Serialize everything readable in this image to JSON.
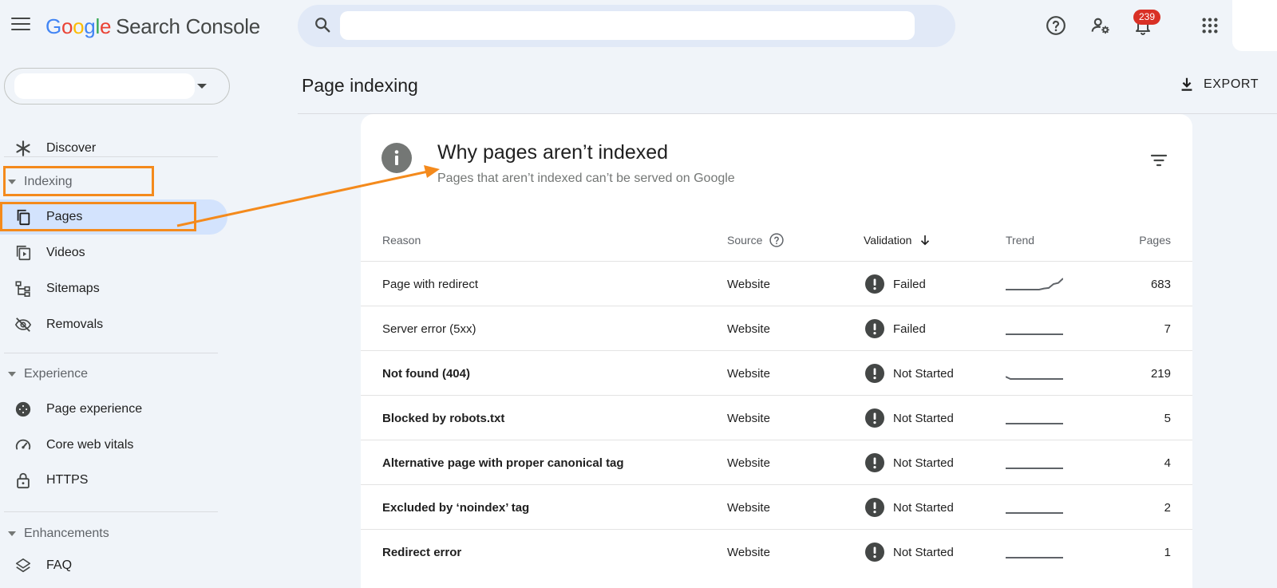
{
  "app": {
    "logo_letters": [
      "G",
      "o",
      "o",
      "g",
      "l",
      "e"
    ],
    "product": "Search Console"
  },
  "topbar": {
    "search_placeholder": "",
    "notification_count": "239",
    "icons": [
      "menu-icon",
      "search-icon",
      "help-icon",
      "admin-settings-icon",
      "notifications-icon",
      "apps-grid-icon"
    ]
  },
  "sidebar": {
    "discover": "Discover",
    "indexing": {
      "label": "Indexing",
      "items": [
        {
          "label": "Pages",
          "icon": "pages-icon",
          "active": true
        },
        {
          "label": "Videos",
          "icon": "video-icon"
        },
        {
          "label": "Sitemaps",
          "icon": "sitemap-icon"
        },
        {
          "label": "Removals",
          "icon": "removals-icon"
        }
      ]
    },
    "experience": {
      "label": "Experience",
      "items": [
        {
          "label": "Page experience",
          "icon": "page-experience-icon"
        },
        {
          "label": "Core web vitals",
          "icon": "speed-gauge-icon"
        },
        {
          "label": "HTTPS",
          "icon": "lock-icon"
        }
      ]
    },
    "enhancements": {
      "label": "Enhancements",
      "items": [
        {
          "label": "FAQ",
          "icon": "layers-icon"
        }
      ]
    }
  },
  "main": {
    "page_title": "Page indexing",
    "export_label": "EXPORT",
    "card": {
      "title": "Why pages aren’t indexed",
      "subtitle": "Pages that aren’t indexed can’t be served on Google",
      "columns": {
        "reason": "Reason",
        "source": "Source",
        "validation": "Validation",
        "trend": "Trend",
        "pages": "Pages"
      },
      "rows": [
        {
          "reason": "Page with redirect",
          "source": "Website",
          "validation": "Failed",
          "trend": [
            0,
            0,
            0,
            0,
            0,
            0,
            0,
            0,
            0.1,
            0.15,
            0.5,
            0.6,
            1
          ],
          "pages": "683",
          "bold": false
        },
        {
          "reason": "Server error (5xx)",
          "source": "Website",
          "validation": "Failed",
          "trend": [
            0,
            0,
            0,
            0,
            0,
            0,
            0,
            0,
            0,
            0,
            0,
            0,
            0
          ],
          "pages": "7",
          "bold": false
        },
        {
          "reason": "Not found (404)",
          "source": "Website",
          "validation": "Not Started",
          "trend": [
            0.2,
            0,
            0,
            0,
            0,
            0,
            0,
            0,
            0,
            0,
            0,
            0,
            0
          ],
          "pages": "219",
          "bold": true
        },
        {
          "reason": "Blocked by robots.txt",
          "source": "Website",
          "validation": "Not Started",
          "trend": [
            0,
            0,
            0,
            0,
            0,
            0,
            0,
            0,
            0,
            0,
            0,
            0,
            0
          ],
          "pages": "5",
          "bold": true
        },
        {
          "reason": "Alternative page with proper canonical tag",
          "source": "Website",
          "validation": "Not Started",
          "trend": [
            0,
            0,
            0,
            0,
            0,
            0,
            0,
            0,
            0,
            0,
            0,
            0,
            0
          ],
          "pages": "4",
          "bold": true
        },
        {
          "reason": "Excluded by ‘noindex’ tag",
          "source": "Website",
          "validation": "Not Started",
          "trend": [
            0,
            0,
            0,
            0,
            0,
            0,
            0,
            0,
            0,
            0,
            0,
            0,
            0
          ],
          "pages": "2",
          "bold": true
        },
        {
          "reason": "Redirect error",
          "source": "Website",
          "validation": "Not Started",
          "trend": [
            0,
            0,
            0,
            0,
            0,
            0,
            0,
            0,
            0,
            0,
            0,
            0,
            0
          ],
          "pages": "1",
          "bold": true
        }
      ]
    }
  },
  "colors": {
    "background": "#f0f4f9",
    "active_nav": "#d3e3fd",
    "annotation": "#f48a1c",
    "badge": "#d93025",
    "validation_icon": "#444746"
  }
}
